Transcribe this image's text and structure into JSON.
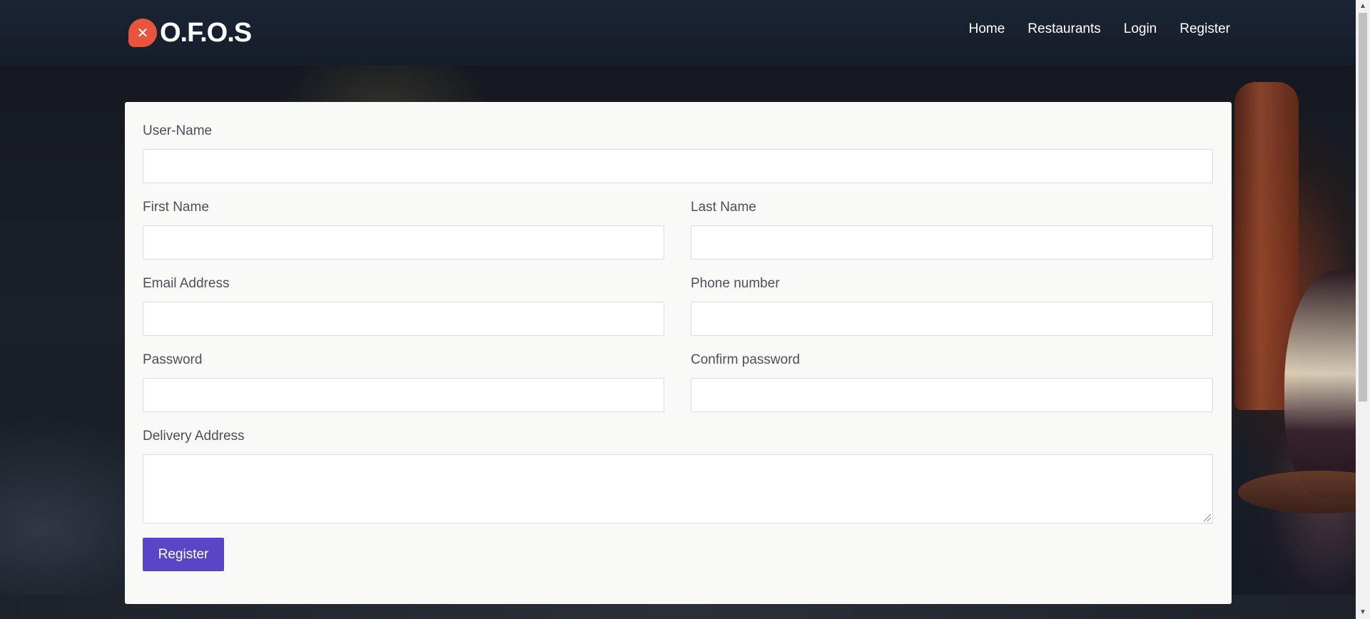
{
  "header": {
    "logo_text": "O.F.O.S",
    "nav": {
      "home": "Home",
      "restaurants": "Restaurants",
      "login": "Login",
      "register": "Register"
    }
  },
  "form": {
    "username_label": "User-Name",
    "first_name_label": "First Name",
    "last_name_label": "Last Name",
    "email_label": "Email Address",
    "phone_label": "Phone number",
    "password_label": "Password",
    "confirm_password_label": "Confirm password",
    "address_label": "Delivery Address",
    "submit_label": "Register"
  },
  "colors": {
    "accent": "#5b45c7",
    "logo": "#e8553c",
    "header_bg": "#1b2433"
  }
}
